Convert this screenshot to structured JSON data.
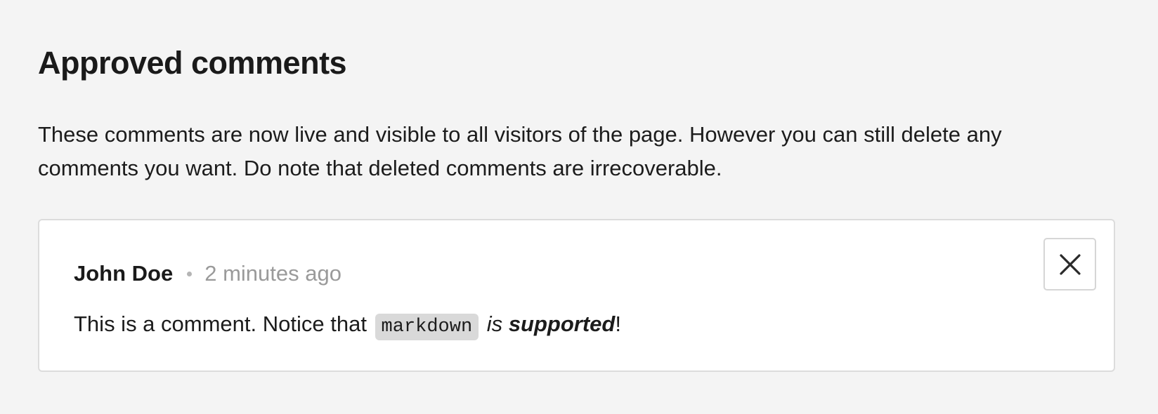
{
  "page": {
    "title": "Approved comments",
    "description": "These comments are now live and visible to all visitors of the page. However you can still delete any comments you want. Do note that deleted comments are irrecoverable."
  },
  "comments": [
    {
      "author": "John Doe",
      "time": "2 minutes ago",
      "body": {
        "text_1": "This is a comment. Notice that ",
        "code": "markdown",
        "text_2": " ",
        "em": "is",
        "text_3": " ",
        "strong_em": "supported",
        "text_4": "!"
      },
      "delete_icon": "close-icon"
    }
  ],
  "colors": {
    "background": "#f4f4f4",
    "card": "#ffffff",
    "card_border": "#dcdcdc",
    "muted_text": "#9a9a9a",
    "code_background": "#d9d9d9"
  }
}
